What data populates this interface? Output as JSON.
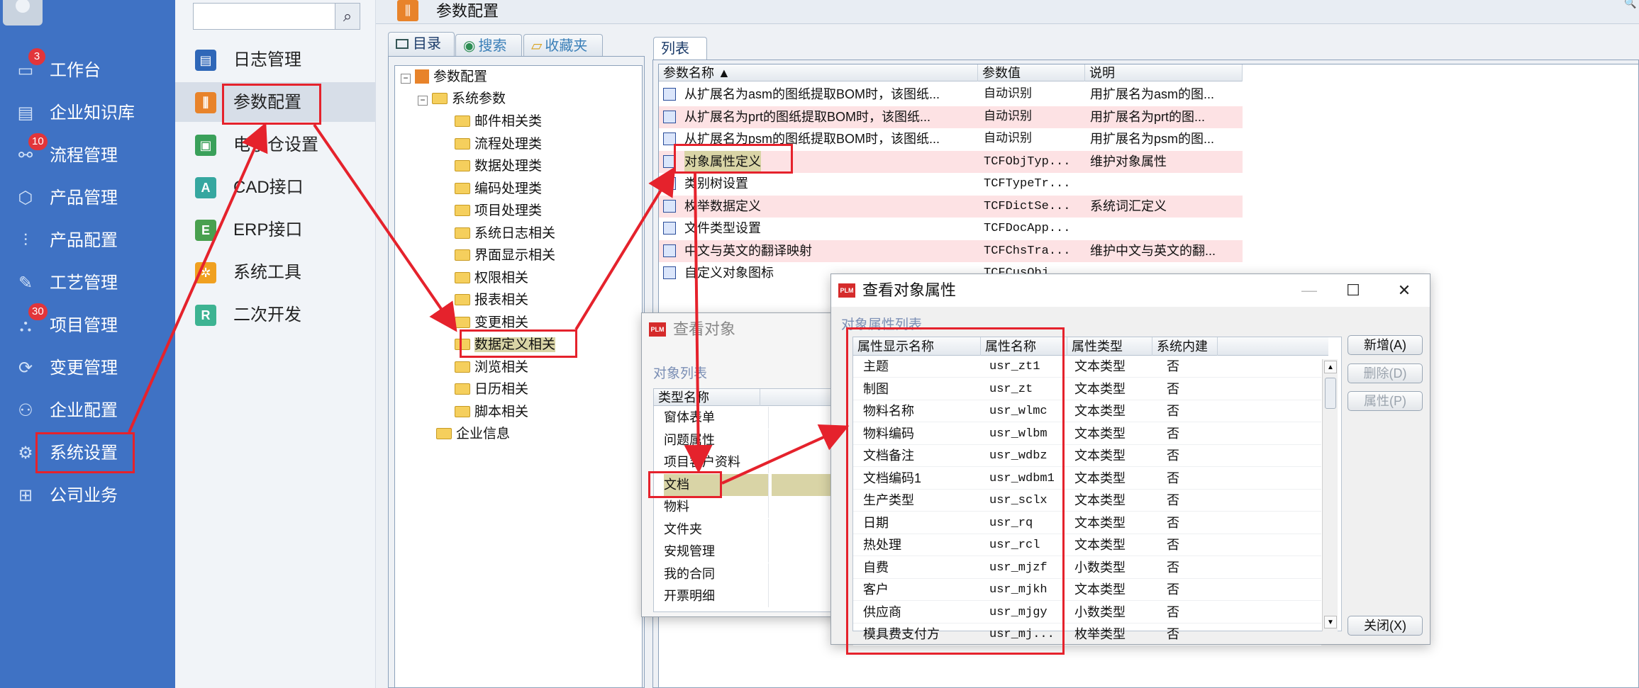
{
  "left_nav": {
    "items": [
      {
        "icon": "monitor-icon",
        "label": "工作台",
        "badge": "3"
      },
      {
        "icon": "knowledge-icon",
        "label": "企业知识库",
        "badge": ""
      },
      {
        "icon": "workflow-icon",
        "label": "流程管理",
        "badge": "10"
      },
      {
        "icon": "cube-icon",
        "label": "产品管理",
        "badge": ""
      },
      {
        "icon": "sliders-icon",
        "label": "产品配置",
        "badge": ""
      },
      {
        "icon": "wrench-icon",
        "label": "工艺管理",
        "badge": ""
      },
      {
        "icon": "project-icon",
        "label": "项目管理",
        "badge": "30"
      },
      {
        "icon": "change-icon",
        "label": "变更管理",
        "badge": ""
      },
      {
        "icon": "org-icon",
        "label": "企业配置",
        "badge": ""
      },
      {
        "icon": "gear-icon",
        "label": "系统设置",
        "badge": ""
      },
      {
        "icon": "grid-icon",
        "label": "公司业务",
        "badge": ""
      }
    ]
  },
  "sub_nav": {
    "search_placeholder": "",
    "items": [
      {
        "icon": "log-icon",
        "glyph": "▤",
        "color": "#2f67b8",
        "label": "日志管理"
      },
      {
        "icon": "params-icon",
        "glyph": "⫼",
        "color": "#e8832a",
        "label": "参数配置"
      },
      {
        "icon": "warehouse-icon",
        "glyph": "▣",
        "color": "#3aa05a",
        "label": "电子仓设置"
      },
      {
        "icon": "cad-icon",
        "glyph": "A",
        "color": "#36a7a0",
        "label": "CAD接口"
      },
      {
        "icon": "erp-icon",
        "glyph": "E",
        "color": "#49a04f",
        "label": "ERP接口"
      },
      {
        "icon": "tools-icon",
        "glyph": "✲",
        "color": "#f0a020",
        "label": "系统工具"
      },
      {
        "icon": "dev-icon",
        "glyph": "R",
        "color": "#3db392",
        "label": "二次开发"
      }
    ]
  },
  "header": {
    "title": "参数配置",
    "search_glyph": "🔍"
  },
  "left_tabs": [
    {
      "icon": "directory-icon",
      "label": "目录"
    },
    {
      "icon": "search-icon",
      "label": "搜索"
    },
    {
      "icon": "favorites-icon",
      "label": "收藏夹"
    }
  ],
  "tree": {
    "root": "参数配置",
    "group": "系统参数",
    "children": [
      "邮件相关类",
      "流程处理类",
      "数据处理类",
      "编码处理类",
      "项目处理类",
      "系统日志相关",
      "界面显示相关",
      "权限相关",
      "报表相关",
      "变更相关",
      "数据定义相关",
      "浏览相关",
      "日历相关",
      "脚本相关"
    ],
    "sibling": "企业信息"
  },
  "right_tab": "列表",
  "param_table": {
    "columns": [
      "参数名称 ▲",
      "参数值",
      "说明"
    ],
    "rows": [
      {
        "name": "从扩展名为asm的图纸提取BOM时，该图纸...",
        "value": "自动识别",
        "desc": "用扩展名为asm的图...",
        "pink": false
      },
      {
        "name": "从扩展名为prt的图纸提取BOM时，该图纸...",
        "value": "自动识别",
        "desc": "用扩展名为prt的图...",
        "pink": true
      },
      {
        "name": "从扩展名为psm的图纸提取BOM时，该图纸...",
        "value": "自动识别",
        "desc": "用扩展名为psm的图...",
        "pink": false
      },
      {
        "name": "对象属性定义",
        "value": "TCFObjTyp...",
        "desc": "维护对象属性",
        "pink": true
      },
      {
        "name": "类别树设置",
        "value": "TCFTypeTr...",
        "desc": "",
        "pink": false
      },
      {
        "name": "枚举数据定义",
        "value": "TCFDictSe...",
        "desc": "系统词汇定义",
        "pink": true
      },
      {
        "name": "文件类型设置",
        "value": "TCFDocApp...",
        "desc": "",
        "pink": false
      },
      {
        "name": "中文与英文的翻译映射",
        "value": "TCFChsTra...",
        "desc": "维护中文与英文的翻...",
        "pink": true
      },
      {
        "name": "自定义对象图标",
        "value": "TCFCusObj...",
        "desc": "",
        "pink": false
      }
    ]
  },
  "dialog_objects": {
    "title": "查看对象",
    "list_label": "对象列表",
    "column": "类型名称",
    "items": [
      "窗体表单",
      "问题属性",
      "项目客户资料",
      "文档",
      "物料",
      "文件夹",
      "安规管理",
      "我的合同",
      "开票明细"
    ]
  },
  "dialog_attrs": {
    "title": "查看对象属性",
    "list_label": "对象属性列表",
    "columns": [
      "属性显示名称",
      "属性名称",
      "属性类型",
      "系统内建"
    ],
    "rows": [
      [
        "主题",
        "usr_zt1",
        "文本类型",
        "否"
      ],
      [
        "制图",
        "usr_zt",
        "文本类型",
        "否"
      ],
      [
        "物料名称",
        "usr_wlmc",
        "文本类型",
        "否"
      ],
      [
        "物料编码",
        "usr_wlbm",
        "文本类型",
        "否"
      ],
      [
        "文档备注",
        "usr_wdbz",
        "文本类型",
        "否"
      ],
      [
        "文档编码1",
        "usr_wdbm1",
        "文本类型",
        "否"
      ],
      [
        "生产类型",
        "usr_sclx",
        "文本类型",
        "否"
      ],
      [
        "日期",
        "usr_rq",
        "文本类型",
        "否"
      ],
      [
        "热处理",
        "usr_rcl",
        "文本类型",
        "否"
      ],
      [
        "自费",
        "usr_mjzf",
        "小数类型",
        "否"
      ],
      [
        "客户",
        "usr_mjkh",
        "文本类型",
        "否"
      ],
      [
        "供应商",
        "usr_mjgy",
        "小数类型",
        "否"
      ],
      [
        "模具费支付方",
        "usr_mj...",
        "枚举类型",
        "否"
      ]
    ],
    "buttons": {
      "add": "新增(A)",
      "delete": "删除(D)",
      "props": "属性(P)",
      "close": "关闭(X)"
    },
    "win": {
      "min": "—",
      "max": "☐",
      "close": "✕"
    }
  },
  "colors": {
    "nav_bg": "#3f72c4",
    "highlight": "#e5222c",
    "badge": "#e2353a",
    "row_pink": "#fde2e4"
  }
}
